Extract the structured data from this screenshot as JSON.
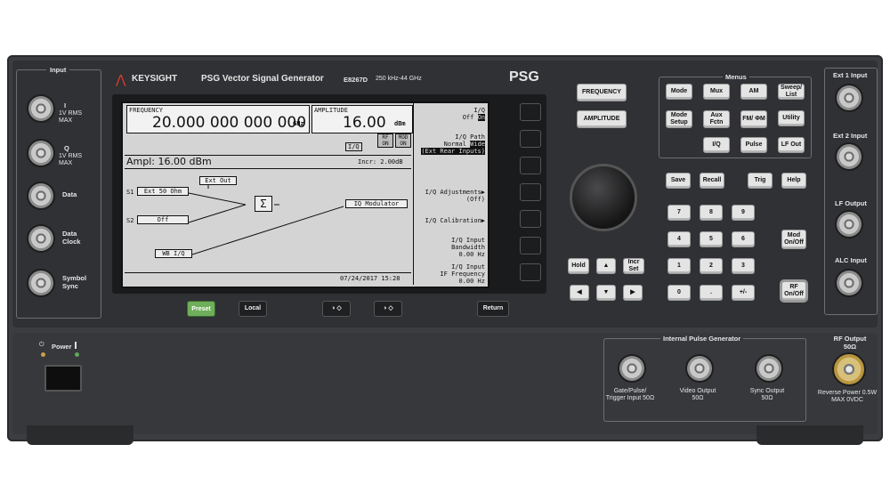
{
  "brand": {
    "name": "KEYSIGHT",
    "product": "PSG Vector Signal Generator",
    "model": "E8267D",
    "range": "250 kHz-44 GHz",
    "badge": "PSG"
  },
  "input_panel": {
    "title": "Input",
    "ports": [
      {
        "label": "I",
        "sub": "1V RMS MAX"
      },
      {
        "label": "Q",
        "sub": "1V RMS MAX"
      },
      {
        "label": "Data",
        "sub": ""
      },
      {
        "label": "Data Clock",
        "sub": ""
      },
      {
        "label": "Symbol Sync",
        "sub": ""
      }
    ]
  },
  "screen": {
    "freq_label": "FREQUENCY",
    "freq_value": "20.000 000 000 000",
    "freq_unit": "GHz",
    "amp_label": "AMPLITUDE",
    "amp_value": "16.00",
    "amp_unit": "dBm",
    "iq_tag": "I/Q",
    "rf_on": "RF ON",
    "mod_on": "MOD ON",
    "ampl_line": "Ampl: 16.00 dBm",
    "incr": "Incr: 2.00dB",
    "s1": "S1",
    "s1_box": "Ext 50 Ohm",
    "ext_out": "Ext Out",
    "s2": "S2",
    "s2_box": "Off",
    "sum": "Σ",
    "iq_mod": "IQ Modulator",
    "wb": "WB I/Q",
    "timestamp": "07/24/2017 15:28",
    "softkeys": [
      {
        "l1": "I/Q",
        "l2": "Off",
        "l2b": "On"
      },
      {
        "l1": "I/Q Path",
        "l2": "Normal",
        "l2b": "Wide",
        "l3": "(Ext Rear Inputs)"
      },
      {
        "l1": "I/Q Adjustments▶",
        "l2": "(Off)"
      },
      {
        "l1": "I/Q Calibration▶"
      },
      {
        "l1": "I/Q Input",
        "l2": "Bandwidth",
        "l3": "0.00 Hz"
      },
      {
        "l1": "I/Q Input",
        "l2": "IF Frequency",
        "l3": "0.00 Hz"
      }
    ]
  },
  "below_screen": {
    "preset": "Preset",
    "local": "Local",
    "contrast1": "◑ ◇",
    "contrast2": "◑ ◇",
    "return": "Return"
  },
  "main_keys": {
    "frequency": "FREQUENCY",
    "amplitude": "AMPLITUDE"
  },
  "menus": {
    "title": "Menus",
    "keys": [
      "Mode",
      "Mux",
      "AM",
      "Sweep/ List",
      "Mode Setup",
      "Aux Fctn",
      "FM/ ΦM",
      "Utility",
      "I/Q",
      "Pulse",
      "LF Out"
    ]
  },
  "func_keys": {
    "save": "Save",
    "recall": "Recall",
    "trig": "Trig",
    "help": "Help"
  },
  "keypad": [
    "7",
    "8",
    "9",
    "4",
    "5",
    "6",
    "1",
    "2",
    "3",
    "0",
    ".",
    "+/-"
  ],
  "nav": {
    "hold": "Hold",
    "incr_set": "Incr Set",
    "up": "▲",
    "left": "◀",
    "down": "▼",
    "right": "▶"
  },
  "side_keys": {
    "mod_onoff": "Mod On/Off",
    "rf_onoff": "RF On/Off"
  },
  "right_panel": {
    "ext1": "Ext 1 Input",
    "ext2": "Ext 2 Input",
    "lf_out": "LF Output",
    "alc": "ALC Input"
  },
  "pulse": {
    "title": "Internal Pulse Generator",
    "ports": [
      "Gate/Pulse/ Trigger Input 50Ω",
      "Video Output 50Ω",
      "Sync Output 50Ω"
    ]
  },
  "rf_output": {
    "title": "RF Output 50Ω",
    "warn": "Reverse Power 0.5W MAX 0VDC"
  },
  "power": {
    "label": "Power"
  }
}
